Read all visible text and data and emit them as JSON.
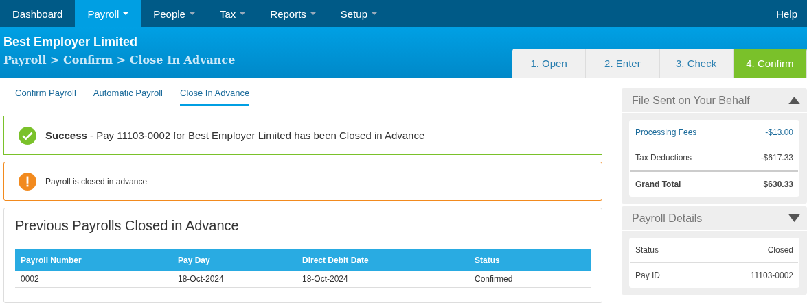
{
  "nav": {
    "items": [
      {
        "label": "Dashboard",
        "selected": false,
        "dropdown": false
      },
      {
        "label": "Payroll",
        "selected": true,
        "dropdown": true
      },
      {
        "label": "People",
        "selected": false,
        "dropdown": true
      },
      {
        "label": "Tax",
        "selected": false,
        "dropdown": true
      },
      {
        "label": "Reports",
        "selected": false,
        "dropdown": true
      },
      {
        "label": "Setup",
        "selected": false,
        "dropdown": true
      }
    ],
    "help": "Help"
  },
  "header": {
    "company": "Best Employer Limited",
    "breadcrumb": "Payroll > Confirm > Close In Advance",
    "steps": [
      {
        "label": "1. Open",
        "selected": false
      },
      {
        "label": "2. Enter",
        "selected": false
      },
      {
        "label": "3. Check",
        "selected": false
      },
      {
        "label": "4. Confirm",
        "selected": true
      }
    ]
  },
  "subtabs": [
    {
      "label": "Confirm Payroll",
      "selected": false
    },
    {
      "label": "Automatic Payroll",
      "selected": false
    },
    {
      "label": "Close In Advance",
      "selected": true
    }
  ],
  "alerts": [
    {
      "kind": "success",
      "message": "**Success** - Pay 11103-0002 for Best Employer Limited has been Closed in Advance"
    },
    {
      "kind": "warning",
      "message": "Payroll is closed in advance"
    }
  ],
  "table": {
    "title": "Previous Payrolls Closed in Advance",
    "columns": [
      "Payroll Number",
      "Pay Day",
      "Direct Debit Date",
      "Status"
    ],
    "rows": [
      [
        "0002",
        "18-Oct-2024",
        "18-Oct-2024",
        "Confirmed"
      ]
    ]
  },
  "panels": [
    {
      "title": "File Sent on Your Behalf",
      "expanded": true,
      "rows": [
        {
          "kind": "link",
          "label": "Processing Fees",
          "value": "-$13.00"
        },
        {
          "kind": "plain",
          "label": "Tax Deductions",
          "value": "-$617.33"
        },
        {
          "kind": "total",
          "label": "Grand Total",
          "value": "$630.33"
        }
      ]
    },
    {
      "title": "Payroll Details",
      "expanded": false,
      "rows": [
        {
          "kind": "plain",
          "label": "Status",
          "value": "Closed"
        },
        {
          "kind": "plain",
          "label": "Pay ID",
          "value": "11103-0002"
        }
      ]
    }
  ]
}
